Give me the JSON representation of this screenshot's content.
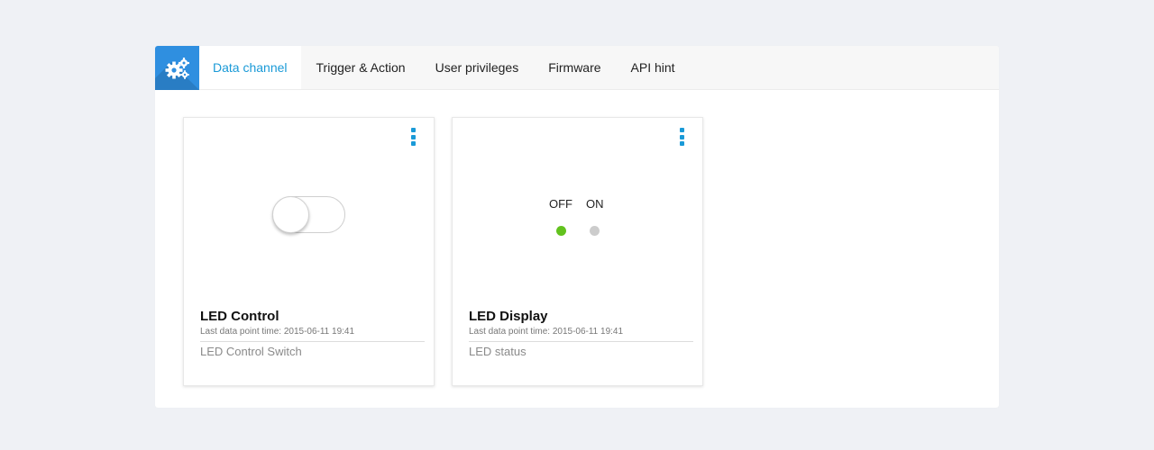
{
  "header": {
    "logo_icon": "gears-icon",
    "accent_color": "#2f8fe0",
    "tabs": [
      {
        "label": "Data channel",
        "active": true
      },
      {
        "label": "Trigger & Action",
        "active": false
      },
      {
        "label": "User privileges",
        "active": false
      },
      {
        "label": "Firmware",
        "active": false
      },
      {
        "label": "API hint",
        "active": false
      }
    ]
  },
  "cards": [
    {
      "type": "switch",
      "switch_state": "off",
      "menu_icon": "kebab-menu-icon",
      "title": "LED Control",
      "time": "Last data point time: 2015-06-11 19:41",
      "description": "LED Control Switch"
    },
    {
      "type": "indicator",
      "menu_icon": "kebab-menu-icon",
      "off_label": "OFF",
      "on_label": "ON",
      "off_color": "#62c21e",
      "on_color": "#cccccc",
      "active_state": "off",
      "title": "LED Display",
      "time": "Last data point time: 2015-06-11 19:41",
      "description": "LED status"
    }
  ]
}
